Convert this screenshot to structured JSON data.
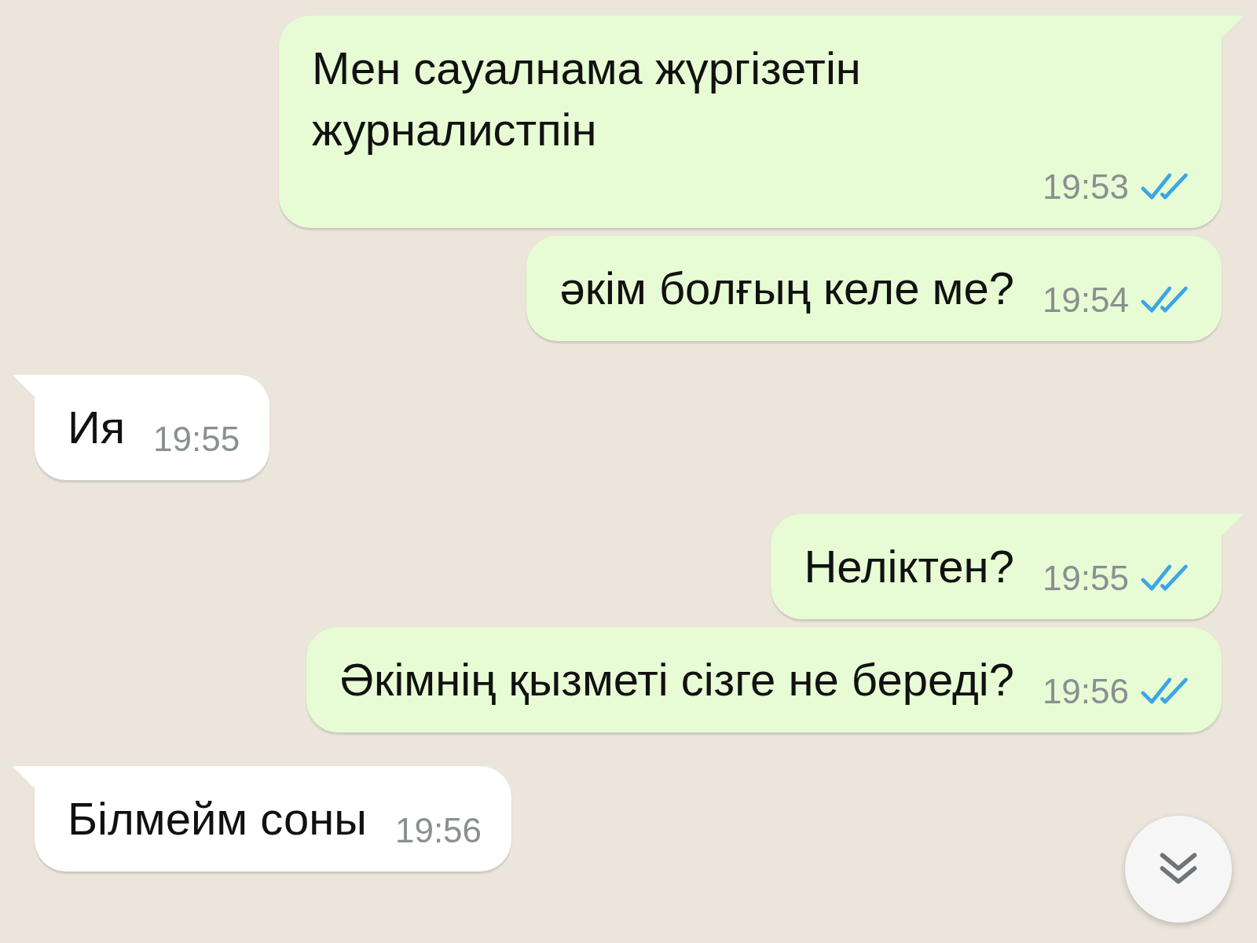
{
  "messages": [
    {
      "kind": "out",
      "text": "Мен сауалнама жүргізетін журналистпін",
      "time": "19:53",
      "read": true,
      "tail": true
    },
    {
      "kind": "out",
      "text": "әкім болғың келе ме?",
      "time": "19:54",
      "read": true,
      "tail": false
    },
    {
      "kind": "in",
      "text": "Ия",
      "time": "19:55",
      "tail": true
    },
    {
      "kind": "out",
      "text": "Неліктен?",
      "time": "19:55",
      "read": true,
      "tail": true
    },
    {
      "kind": "out",
      "text": "Әкімнің қызметі сізге не береді?",
      "time": "19:56",
      "read": true,
      "tail": false
    },
    {
      "kind": "in",
      "text": "Білмейм соны",
      "time": "19:56",
      "tail": true
    }
  ]
}
